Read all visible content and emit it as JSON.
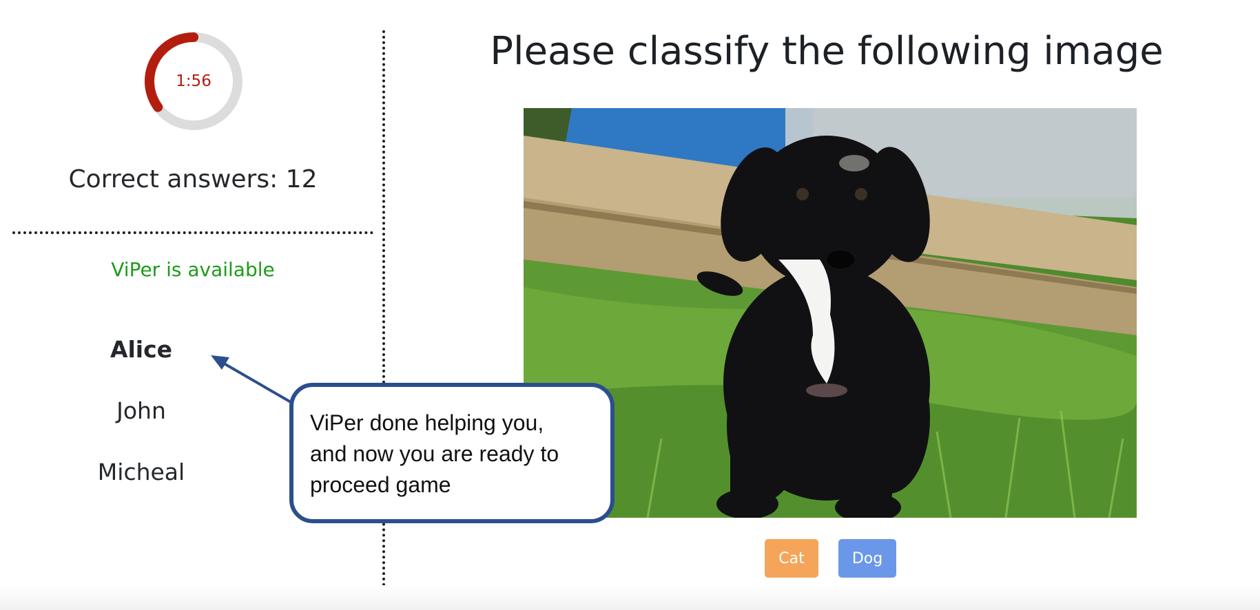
{
  "timer": {
    "label": "1:56",
    "remaining_fraction": 0.35,
    "progress_color": "#b31d10",
    "track_color": "#dcdcdc"
  },
  "score": {
    "text": "Correct answers: 12"
  },
  "status": {
    "text": "ViPer is available",
    "color": "#1e9b1a"
  },
  "players": [
    {
      "name": "Alice",
      "active": true
    },
    {
      "name": "John",
      "active": false
    },
    {
      "name": "Micheal",
      "active": false
    }
  ],
  "main": {
    "title": "Please classify the following image",
    "image_subject": "black puppy sitting on grass"
  },
  "choices": {
    "cat_label": "Cat",
    "dog_label": "Dog",
    "cat_color": "#f4a55a",
    "dog_color": "#6b97e9"
  },
  "callout": {
    "line1": "ViPer done helping you,",
    "line2": "and now you are ready to",
    "line3": "proceed game",
    "border_color": "#2b4f8e"
  }
}
